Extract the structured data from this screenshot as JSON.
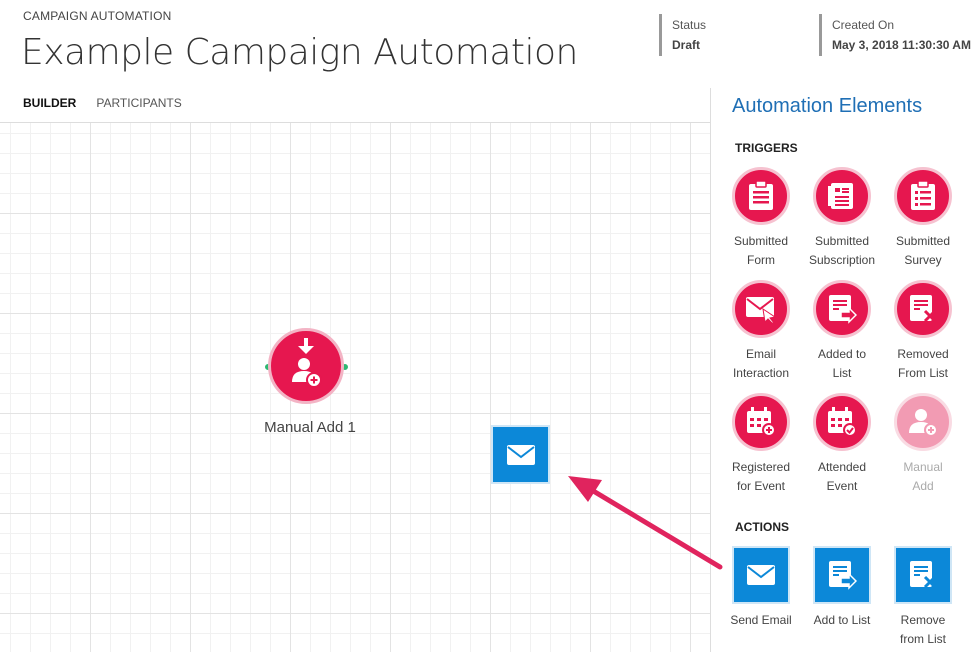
{
  "header": {
    "breadcrumb": "CAMPAIGN AUTOMATION",
    "title": "Example Campaign Automation",
    "status_label": "Status",
    "status_value": "Draft",
    "created_label": "Created On",
    "created_value": "May 3, 2018 11:30:30 AM"
  },
  "tabs": [
    {
      "label": "BUILDER",
      "active": true
    },
    {
      "label": "PARTICIPANTS",
      "active": false
    }
  ],
  "canvas": {
    "node_label": "Manual Add 1",
    "node_icon": "manual-add-icon",
    "dragged_tile_icon": "envelope-icon"
  },
  "panel": {
    "title": "Automation Elements",
    "triggers_title": "TRIGGERS",
    "actions_title": "ACTIONS",
    "triggers": [
      {
        "line1": "Submitted",
        "line2": "Form",
        "icon": "form-icon"
      },
      {
        "line1": "Submitted",
        "line2": "Subscription",
        "icon": "subscription-icon"
      },
      {
        "line1": "Submitted",
        "line2": "Survey",
        "icon": "survey-icon"
      },
      {
        "line1": "Email",
        "line2": "Interaction",
        "icon": "email-interaction-icon"
      },
      {
        "line1": "Added to",
        "line2": "List",
        "icon": "added-to-list-icon"
      },
      {
        "line1": "Removed",
        "line2": "From List",
        "icon": "removed-from-list-icon"
      },
      {
        "line1": "Registered",
        "line2": "for Event",
        "icon": "registered-event-icon"
      },
      {
        "line1": "Attended",
        "line2": "Event",
        "icon": "attended-event-icon"
      },
      {
        "line1": "Manual",
        "line2": "Add",
        "icon": "manual-add-icon",
        "disabled": true
      }
    ],
    "actions": [
      {
        "line1": "Send Email",
        "line2": "",
        "icon": "envelope-icon"
      },
      {
        "line1": "Add to List",
        "line2": "",
        "icon": "add-to-list-icon"
      },
      {
        "line1": "Remove",
        "line2": "from List",
        "icon": "remove-from-list-icon"
      }
    ]
  },
  "colors": {
    "trigger": "#e6174f",
    "action": "#0c88d8",
    "arrow": "#e0245e",
    "panel_title": "#1f6fb5"
  }
}
